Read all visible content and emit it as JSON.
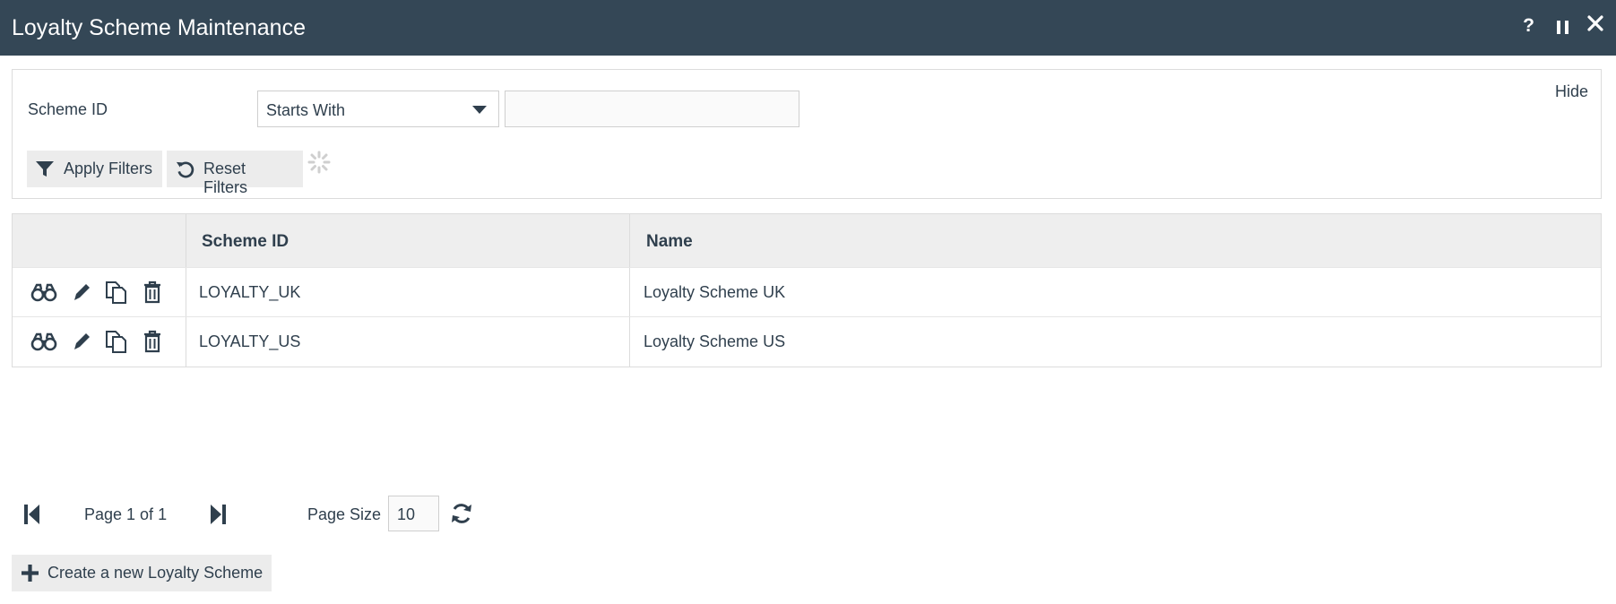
{
  "window": {
    "title": "Loyalty Scheme Maintenance",
    "help_label": "?"
  },
  "filters": {
    "scheme_id_label": "Scheme ID",
    "operator_selected": "Starts With",
    "value": "",
    "hide_label": "Hide",
    "apply_label": "Apply Filters",
    "reset_label": "Reset Filters"
  },
  "grid": {
    "columns": [
      "Scheme ID",
      "Name"
    ],
    "row_actions": [
      "view-icon",
      "edit-icon",
      "copy-icon",
      "delete-icon"
    ],
    "rows": [
      {
        "scheme_id": "LOYALTY_UK",
        "name": "Loyalty Scheme UK"
      },
      {
        "scheme_id": "LOYALTY_US",
        "name": "Loyalty Scheme US"
      }
    ]
  },
  "pager": {
    "page_info": "Page 1 of 1",
    "page_size_label": "Page Size",
    "page_size": "10"
  },
  "create_label": "Create a new Loyalty Scheme",
  "colors": {
    "titlebar": "#344756",
    "text": "#2f3f4d",
    "button_bg": "#ececec",
    "header_bg": "#eeeeee"
  }
}
